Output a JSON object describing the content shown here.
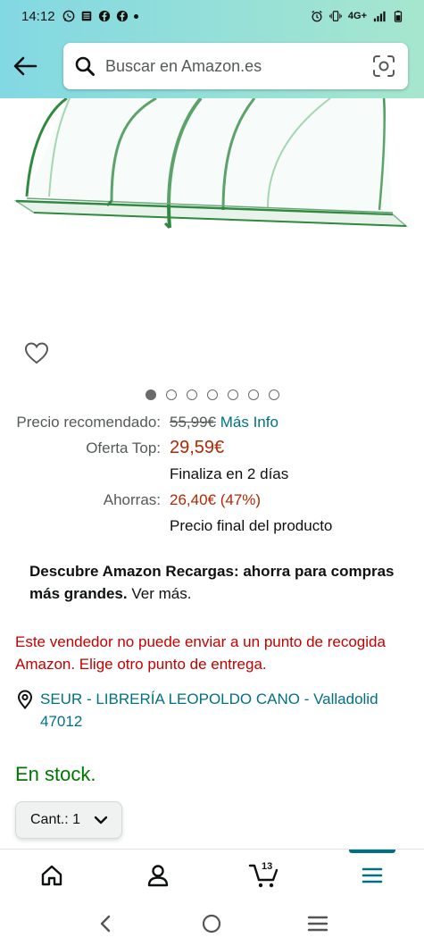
{
  "status_bar": {
    "time": "14:12",
    "left_icons": [
      "whatsapp-icon",
      "news-icon",
      "facebook-icon",
      "facebook-icon",
      "dot"
    ],
    "right_icons": [
      "alarm-icon",
      "vibrate-icon",
      "signal-icon",
      "battery-icon"
    ],
    "network": "4G+"
  },
  "header": {
    "back_icon": "arrow-left-icon",
    "search_placeholder": "Buscar en Amazon.es",
    "lens_icon": "camera-search-icon",
    "gradient_start": "#82d8e3",
    "gradient_end": "#a6e6ce"
  },
  "product": {
    "image": "greenhouse-tunnel",
    "wishlist_icon": "heart-icon",
    "carousel": {
      "total": 7,
      "active": 1
    }
  },
  "pricing": {
    "recommended_label": "Precio recomendado:",
    "recommended_value": "55,99€",
    "more_info": "Más Info",
    "offer_label": "Oferta Top:",
    "offer_value": "29,59€",
    "offer_ends": "Finaliza en 2 días",
    "savings_label": "Ahorras:",
    "savings_value": "26,40€ (47%)",
    "final_note": "Precio final del producto"
  },
  "promo": {
    "bold_text": "Descubre Amazon Recargas: ahorra para compras más grandes.",
    "link_text": " Ver más."
  },
  "warning": "Este vendedor no puede enviar a un punto de recogida Amazon. Elige otro punto de entrega.",
  "location": {
    "icon": "location-pin-icon",
    "text": "SEUR - LIBRERÍA LEOPOLDO CANO - Valladolid 47012"
  },
  "stock": "En stock.",
  "quantity": {
    "label": "Cant.:",
    "value": "1"
  },
  "bottom_nav": {
    "items": [
      "home-icon",
      "account-icon",
      "cart-icon",
      "menu-icon"
    ],
    "cart_count": "13",
    "active": "menu"
  },
  "colors": {
    "link": "#007185",
    "price_red": "#b12704",
    "warning_red": "#c40000",
    "stock_green": "#007600"
  }
}
